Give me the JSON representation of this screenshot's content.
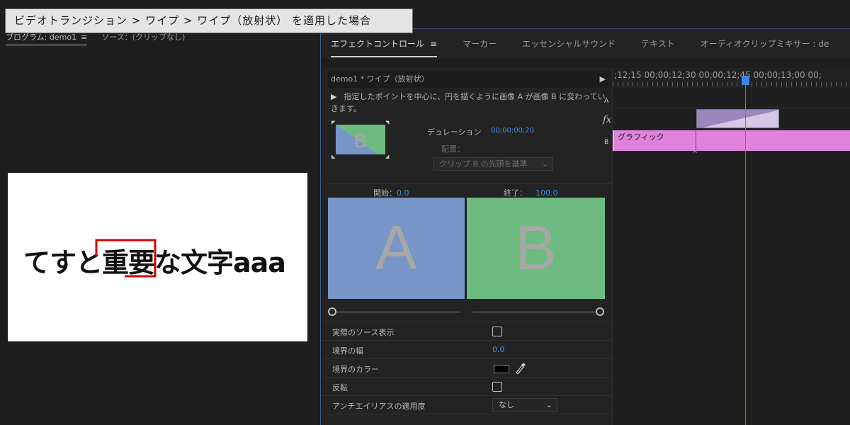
{
  "caption": "ビデオトランジション >  ワイプ > ワイプ（放射状） を適用した場合",
  "program": {
    "tab_program": "プログラム: demo1",
    "tab_source": "ソース：(クリップなし)",
    "menu_icon": "≡",
    "preview_text": "てすと重要な文字aaa"
  },
  "effect_tabs": {
    "effect_controls": "エフェクトコントロール",
    "menu_icon": "≡",
    "marker": "マーカー",
    "essential_sound": "エッセンシャルサウンド",
    "text": "テキスト",
    "audio_mixer": "オーディオクリップミキサー : de"
  },
  "effect": {
    "title": "demo1 * ワイプ（放射状）",
    "expand_icon": "▶",
    "play_icon": "▶",
    "description": "指定したポイントを中心に、円を描くように画像 A が画像 B に変わっていきます。",
    "thumb_letter": "B",
    "duration_label": "デュレーション",
    "duration_value": "00;00;00;20",
    "align_label": "配置：",
    "align_value": "クリップ B の先頭を基準",
    "start_label": "開始：",
    "start_value": "0.0",
    "end_label": "終了：",
    "end_value": "100.0",
    "letter_a": "A",
    "letter_b": "B",
    "color_a": "#7795c7",
    "color_b": "#6dbb80"
  },
  "props": {
    "show_actual_sources": "実際のソース表示",
    "border_width_label": "境界の幅",
    "border_width_value": "0.0",
    "border_color_label": "境界のカラー",
    "reverse_label": "反転",
    "anti_alias_label": "アンチエイリアスの適用度",
    "anti_alias_value": "なし",
    "eyedropper_icon": "eyedropper-icon"
  },
  "timeline": {
    "ruler_text": ";12;15 00;00;12;30 00;00;12;45 00;00;13;00 00;",
    "track_a": "A",
    "fx_icon": "fx",
    "track_b": "B",
    "graphic_clip": "グラフィック"
  }
}
